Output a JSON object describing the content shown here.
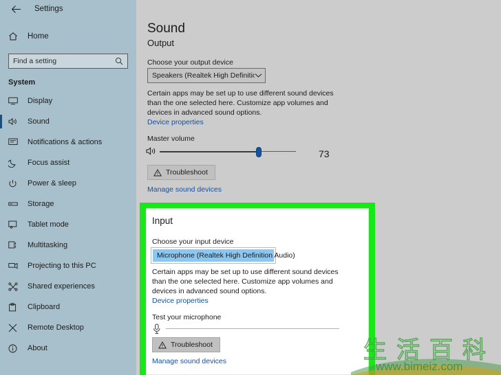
{
  "window": {
    "back_icon": "back-arrow-icon",
    "title": "Settings"
  },
  "sidebar": {
    "home_label": "Home",
    "home_icon": "home-icon",
    "search": {
      "placeholder": "Find a setting",
      "value": "",
      "icon": "search-icon"
    },
    "section_label": "System",
    "items": [
      {
        "label": "Display",
        "icon": "monitor-icon",
        "selected": false
      },
      {
        "label": "Sound",
        "icon": "speaker-icon",
        "selected": true
      },
      {
        "label": "Notifications & actions",
        "icon": "notification-icon",
        "selected": false
      },
      {
        "label": "Focus assist",
        "icon": "moon-icon",
        "selected": false
      },
      {
        "label": "Power & sleep",
        "icon": "power-icon",
        "selected": false
      },
      {
        "label": "Storage",
        "icon": "storage-icon",
        "selected": false
      },
      {
        "label": "Tablet mode",
        "icon": "tablet-icon",
        "selected": false
      },
      {
        "label": "Multitasking",
        "icon": "multitasking-icon",
        "selected": false
      },
      {
        "label": "Projecting to this PC",
        "icon": "projecting-icon",
        "selected": false
      },
      {
        "label": "Shared experiences",
        "icon": "share-icon",
        "selected": false
      },
      {
        "label": "Clipboard",
        "icon": "clipboard-icon",
        "selected": false
      },
      {
        "label": "Remote Desktop",
        "icon": "remote-desktop-icon",
        "selected": false
      },
      {
        "label": "About",
        "icon": "info-icon",
        "selected": false
      }
    ]
  },
  "main": {
    "page_title": "Sound",
    "output": {
      "heading": "Output",
      "device_label": "Choose your output device",
      "device_value": "Speakers (Realtek High Definition A...",
      "chevron_icon": "chevron-down-icon",
      "help_text": "Certain apps may be set up to use different sound devices than the one selected here. Customize app volumes and devices in advanced sound options.",
      "device_properties_link": "Device properties",
      "volume_label": "Master volume",
      "volume_icon": "speaker-volume-icon",
      "volume_value": "73",
      "volume_percent": 73,
      "troubleshoot_label": "Troubleshoot",
      "troubleshoot_icon": "warning-triangle-icon",
      "manage_link": "Manage sound devices"
    },
    "input": {
      "heading": "Input",
      "device_label": "Choose your input device",
      "device_option": "Microphone (Realtek High Definition Audio)",
      "help_text": "Certain apps may be set up to use different sound devices than the one selected here. Customize app volumes and devices in advanced sound options.",
      "device_properties_link": "Device properties",
      "test_label": "Test your microphone",
      "mic_icon": "microphone-icon",
      "troubleshoot_label": "Troubleshoot",
      "troubleshoot_icon": "warning-triangle-icon",
      "manage_link": "Manage sound devices"
    }
  },
  "highlight": {
    "color": "#18e819"
  },
  "watermark": {
    "cjk_text": "生活百科",
    "url_text": "www.bimeiz.com",
    "color": "#3e8f3e"
  }
}
